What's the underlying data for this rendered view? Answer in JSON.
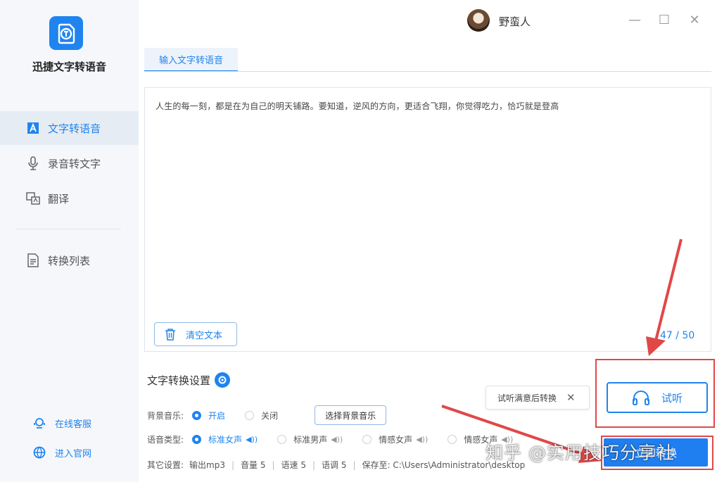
{
  "app": {
    "name": "迅捷文字转语音",
    "logo_icon": "document-speech-logo",
    "accent_color": "#1f84ef",
    "highlight_color": "#e04848"
  },
  "sidebar": {
    "items": [
      {
        "label": "文字转语音",
        "icon": "text-a-icon",
        "active": true
      },
      {
        "label": "录音转文字",
        "icon": "microphone-icon",
        "active": false
      },
      {
        "label": "翻译",
        "icon": "translate-icon",
        "active": false
      },
      {
        "label": "转换列表",
        "icon": "list-icon",
        "active": false
      }
    ],
    "footer": [
      {
        "label": "在线客服",
        "icon": "support-icon"
      },
      {
        "label": "进入官网",
        "icon": "globe-icon"
      }
    ]
  },
  "header": {
    "username": "野蛮人",
    "minimize": "—",
    "maximize": "☐",
    "close": "✕"
  },
  "tabs": [
    {
      "label": "输入文字转语音",
      "active": true
    }
  ],
  "editor": {
    "text": "人生的每一刻，都是在为自己的明天铺路。要知道，逆风的方向，更适合飞翔，你觉得吃力，恰巧就是登高",
    "clear_label": "清空文本",
    "counter": "47 / 50"
  },
  "settings": {
    "title": "文字转换设置",
    "bgm": {
      "label": "背景音乐:",
      "options": [
        {
          "label": "开启",
          "selected": true
        },
        {
          "label": "关闭",
          "selected": false
        }
      ],
      "choose_label": "选择背景音乐"
    },
    "voice": {
      "label": "语音类型:",
      "options": [
        {
          "label": "标准女声",
          "selected": true
        },
        {
          "label": "标准男声",
          "selected": false
        },
        {
          "label": "情感女声",
          "selected": false
        },
        {
          "label": "情感女声",
          "selected": false
        }
      ]
    },
    "other": {
      "label": "其它设置:",
      "format": "输出mp3",
      "volume": "音量 5",
      "speed": "语速 5",
      "pitch": "语调 5",
      "save_to": "保存至: C:\\Users\\Administrator\\desktop"
    }
  },
  "tooltip": {
    "text": "试听满意后转换",
    "close": "✕"
  },
  "actions": {
    "listen_label": "试听",
    "convert_label": "立即转换"
  },
  "watermark": "知乎 @实用技巧分享社"
}
